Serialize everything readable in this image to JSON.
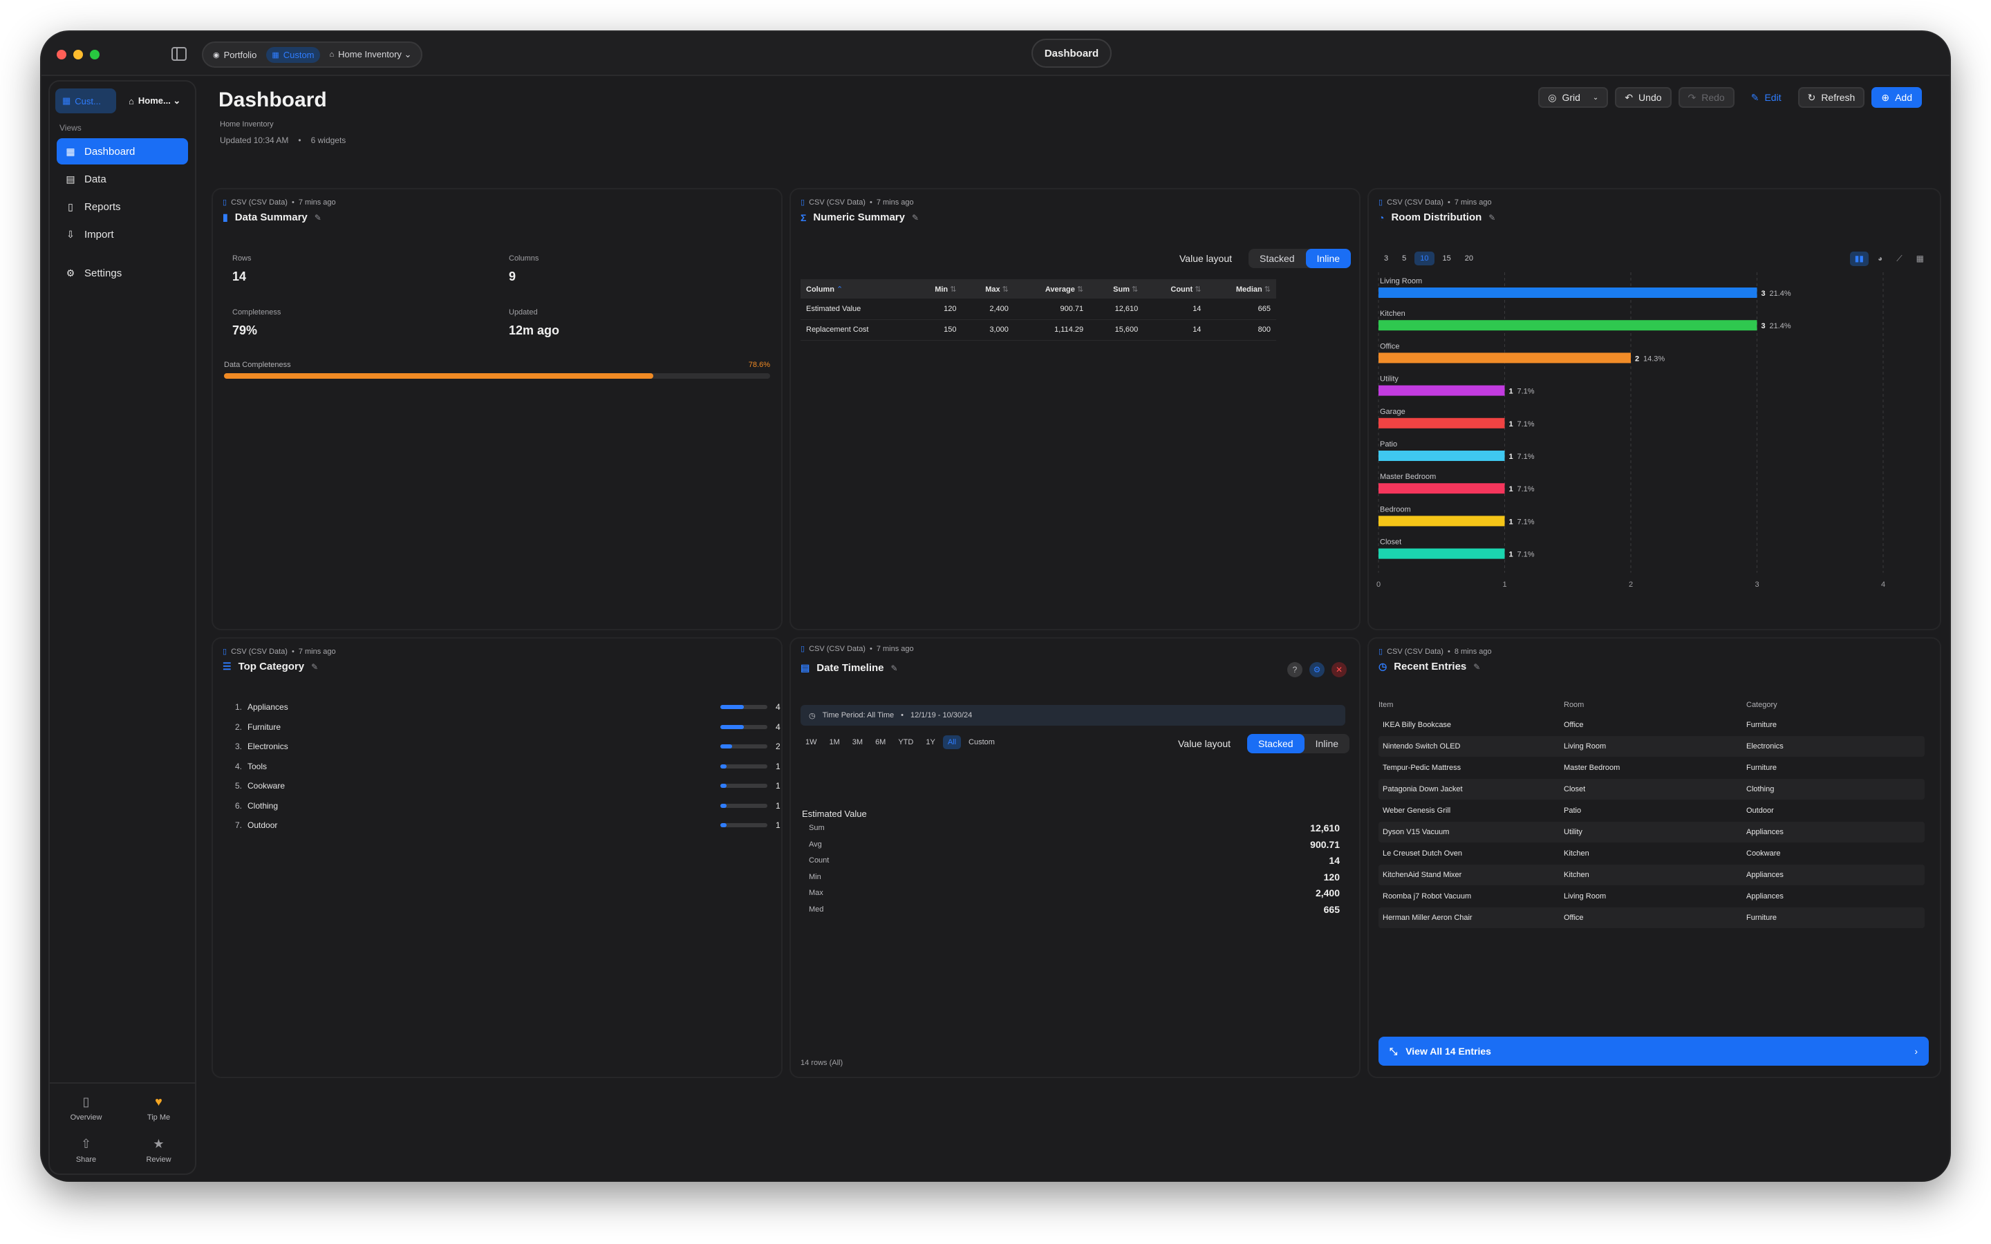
{
  "window": {
    "title_pill": "Dashboard",
    "breadcrumbs": [
      {
        "label": "Portfolio",
        "active": false
      },
      {
        "label": "Custom",
        "active": true
      },
      {
        "label": "Home  Inventory ⌄",
        "active": false
      }
    ]
  },
  "sidebar": {
    "chip_primary": "Cust...",
    "chip_secondary": "Home... ⌄",
    "section_label": "Views",
    "items": [
      {
        "label": "Dashboard",
        "icon": "grid-icon",
        "active": true
      },
      {
        "label": "Data",
        "icon": "table-icon",
        "active": false
      },
      {
        "label": "Reports",
        "icon": "document-icon",
        "active": false
      },
      {
        "label": "Import",
        "icon": "import-icon",
        "active": false
      },
      {
        "label": "Settings",
        "icon": "gear-icon",
        "active": false
      }
    ],
    "bottom": [
      {
        "label": "Overview",
        "icon": "overview-icon"
      },
      {
        "label": "Tip Me",
        "icon": "heart-icon"
      },
      {
        "label": "Share",
        "icon": "share-icon"
      },
      {
        "label": "Review",
        "icon": "star-icon"
      }
    ]
  },
  "header": {
    "title": "Dashboard",
    "subtitle": "Home  Inventory",
    "updated": "Updated 10:34 AM",
    "dot": "•",
    "widgets": "6 widgets"
  },
  "toolbar": {
    "grid": "Grid",
    "undo": "Undo",
    "redo": "Redo",
    "edit": "Edit",
    "refresh": "Refresh",
    "add": "Add"
  },
  "data_summary": {
    "source": "CSV (CSV Data)",
    "age": "7 mins ago",
    "title": "Data Summary",
    "rows_label": "Rows",
    "rows_value": "14",
    "columns_label": "Columns",
    "columns_value": "9",
    "completeness_label": "Completeness",
    "completeness_value": "79%",
    "updated_label": "Updated",
    "updated_value": "12m ago",
    "progress_label": "Data Completeness",
    "progress_text": "78.6%",
    "progress_fraction": 0.786
  },
  "numeric_summary": {
    "source": "CSV (CSV Data)",
    "age": "7 mins ago",
    "title": "Numeric Summary",
    "layout_label": "Value layout",
    "layout_options": [
      "Stacked",
      "Inline"
    ],
    "selected_layout": "Inline",
    "columns": [
      "Column",
      "Min",
      "Max",
      "Average",
      "Sum",
      "Count",
      "Median"
    ],
    "rows": [
      [
        "Estimated Value",
        "120",
        "2,400",
        "900.71",
        "12,610",
        "14",
        "665"
      ],
      [
        "Replacement Cost",
        "150",
        "3,000",
        "1,114.29",
        "15,600",
        "14",
        "800"
      ]
    ]
  },
  "room_distribution": {
    "source": "CSV (CSV Data)",
    "age": "7 mins ago",
    "title": "Room Distribution",
    "top_options": [
      "3",
      "5",
      "10",
      "15",
      "20"
    ],
    "selected_top": "10",
    "view_icons": [
      "bar-chart-icon",
      "pie-chart-icon",
      "line-chart-icon",
      "table-icon"
    ]
  },
  "chart_data": {
    "type": "bar",
    "orientation": "horizontal",
    "categories": [
      "Living Room",
      "Kitchen",
      "Office",
      "Utility",
      "Garage",
      "Patio",
      "Master Bedroom",
      "Bedroom",
      "Closet"
    ],
    "values": [
      3,
      3,
      2,
      1,
      1,
      1,
      1,
      1,
      1
    ],
    "percent_labels": [
      "21.4%",
      "21.4%",
      "14.3%",
      "7.1%",
      "7.1%",
      "7.1%",
      "7.1%",
      "7.1%",
      "7.1%"
    ],
    "colors": [
      "#1a7cf0",
      "#2fc84f",
      "#f28c28",
      "#c23be0",
      "#f04343",
      "#3fc8f0",
      "#f5365c",
      "#f5c518",
      "#1bd6b0"
    ],
    "xlim": [
      0,
      4
    ],
    "xticks": [
      "0",
      "1",
      "2",
      "3",
      "4"
    ],
    "grid": true
  },
  "top_category": {
    "source": "CSV (CSV Data)",
    "age": "7 mins ago",
    "title": "Top Category",
    "max": 4,
    "items": [
      {
        "rank": "1.",
        "label": "Appliances",
        "count": "4",
        "value": 4
      },
      {
        "rank": "2.",
        "label": "Furniture",
        "count": "4",
        "value": 4
      },
      {
        "rank": "3.",
        "label": "Electronics",
        "count": "2",
        "value": 2
      },
      {
        "rank": "4.",
        "label": "Tools",
        "count": "1",
        "value": 1
      },
      {
        "rank": "5.",
        "label": "Cookware",
        "count": "1",
        "value": 1
      },
      {
        "rank": "6.",
        "label": "Clothing",
        "count": "1",
        "value": 1
      },
      {
        "rank": "7.",
        "label": "Outdoor",
        "count": "1",
        "value": 1
      }
    ]
  },
  "date_timeline": {
    "source": "CSV (CSV Data)",
    "age": "7 mins ago",
    "title": "Date Timeline",
    "period_label": "Time Period: All Time",
    "period_range": "12/1/19 - 10/30/24",
    "ranges": [
      "1W",
      "1M",
      "3M",
      "6M",
      "YTD",
      "1Y",
      "All",
      "Custom"
    ],
    "selected_range": "All",
    "layout_label": "Value layout",
    "layout_options": [
      "Stacked",
      "Inline"
    ],
    "selected_layout": "Stacked",
    "metric": "Estimated Value",
    "stats": [
      {
        "label": "Sum",
        "value": "12,610"
      },
      {
        "label": "Avg",
        "value": "900.71"
      },
      {
        "label": "Count",
        "value": "14"
      },
      {
        "label": "Min",
        "value": "120"
      },
      {
        "label": "Max",
        "value": "2,400"
      },
      {
        "label": "Med",
        "value": "665"
      }
    ],
    "footer": "14 rows (All)"
  },
  "recent_entries": {
    "source": "CSV (CSV Data)",
    "age": "8 mins ago",
    "title": "Recent Entries",
    "columns": [
      "Item",
      "Room",
      "Category"
    ],
    "rows": [
      [
        "IKEA Billy Bookcase",
        "Office",
        "Furniture"
      ],
      [
        "Nintendo Switch OLED",
        "Living Room",
        "Electronics"
      ],
      [
        "Tempur-Pedic Mattress",
        "Master Bedroom",
        "Furniture"
      ],
      [
        "Patagonia Down Jacket",
        "Closet",
        "Clothing"
      ],
      [
        "Weber Genesis Grill",
        "Patio",
        "Outdoor"
      ],
      [
        "Dyson V15 Vacuum",
        "Utility",
        "Appliances"
      ],
      [
        "Le Creuset Dutch Oven",
        "Kitchen",
        "Cookware"
      ],
      [
        "KitchenAid Stand Mixer",
        "Kitchen",
        "Appliances"
      ],
      [
        "Roomba j7 Robot Vacuum",
        "Living Room",
        "Appliances"
      ],
      [
        "Herman Miller Aeron Chair",
        "Office",
        "Furniture"
      ]
    ],
    "view_all": "View All 14 Entries"
  }
}
